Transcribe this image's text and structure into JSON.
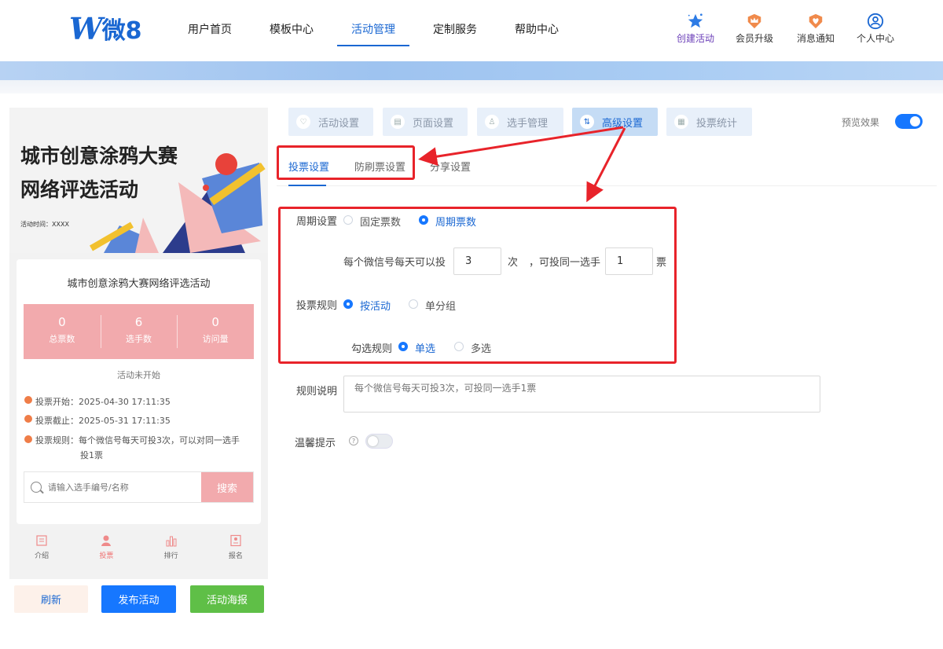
{
  "header": {
    "logo_text": "微8",
    "nav": [
      {
        "label": "用户首页"
      },
      {
        "label": "模板中心"
      },
      {
        "label": "活动管理"
      },
      {
        "label": "定制服务"
      },
      {
        "label": "帮助中心"
      }
    ],
    "actions": [
      {
        "label": "创建活动",
        "icon": "star-icon"
      },
      {
        "label": "会员升级",
        "icon": "crown-badge-icon"
      },
      {
        "label": "消息通知",
        "icon": "heart-badge-icon"
      },
      {
        "label": "个人中心",
        "icon": "user-circle-icon"
      }
    ]
  },
  "preview": {
    "poster_title_line1": "城市创意涂鸦大赛",
    "poster_title_line2": "网络评选活动",
    "poster_time": "活动时间：XXXX",
    "card_title": "城市创意涂鸦大赛网络评选活动",
    "stats": [
      {
        "value": "0",
        "label": "总票数"
      },
      {
        "value": "6",
        "label": "选手数"
      },
      {
        "value": "0",
        "label": "访问量"
      }
    ],
    "status": "活动未开始",
    "vote_start": "投票开始：2025-04-30 17:11:35",
    "vote_end": "投票截止：2025-05-31 17:11:35",
    "vote_rule_line1": "投票规则：每个微信号每天可投3次，可以对同一选手",
    "vote_rule_line2": "投1票",
    "search_placeholder": "请输入选手编号/名称",
    "search_button": "搜索",
    "tabbar": [
      {
        "label": "介绍",
        "icon": "doc-icon"
      },
      {
        "label": "投票",
        "icon": "person-icon"
      },
      {
        "label": "排行",
        "icon": "bar-chart-icon"
      },
      {
        "label": "报名",
        "icon": "form-icon"
      }
    ]
  },
  "buttons": {
    "refresh": "刷新",
    "publish": "发布活动",
    "poster": "活动海报"
  },
  "steps": [
    {
      "label": "活动设置"
    },
    {
      "label": "页面设置"
    },
    {
      "label": "选手管理"
    },
    {
      "label": "高级设置"
    },
    {
      "label": "投票统计"
    }
  ],
  "preview_toggle_label": "预览效果",
  "sub_tabs": [
    {
      "label": "投票设置"
    },
    {
      "label": "防刷票设置"
    },
    {
      "label": "分享设置"
    }
  ],
  "form": {
    "period_label": "周期设置",
    "period_fixed": "固定票数",
    "period_cycle": "周期票数",
    "daily_prefix": "每个微信号每天可以投",
    "daily_value": "3",
    "daily_unit": "次",
    "same_prefix": "，可投同一选手",
    "same_value": "1",
    "same_unit": "票",
    "rule_label": "投票规则",
    "rule_by_activity": "按活动",
    "rule_by_group": "单分组",
    "select_label": "勾选规则",
    "select_single": "单选",
    "select_multi": "多选",
    "desc_label": "规则说明",
    "desc_placeholder": "每个微信号每天可投3次，可投同一选手1票",
    "tip_label": "温馨提示"
  },
  "colors": {
    "brand": "#1a67d2",
    "stats_bg": "#f2aaad",
    "annotation": "#e8232a",
    "publish": "#1677ff",
    "poster_btn": "#5fbf47"
  }
}
